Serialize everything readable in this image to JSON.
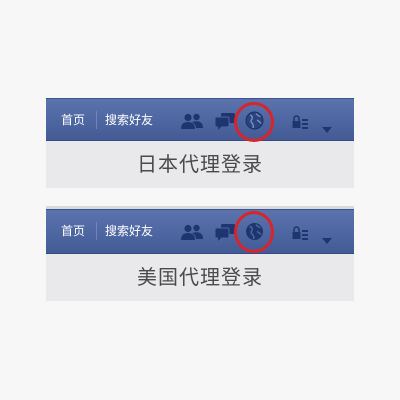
{
  "panels": [
    {
      "nav": {
        "home_label": "首页",
        "find_friends_label": "搜索好友"
      },
      "caption": "日本代理登录",
      "globe_style": "faded"
    },
    {
      "nav": {
        "home_label": "首页",
        "find_friends_label": "搜索好友"
      },
      "caption": "美国代理登录",
      "globe_style": "solid"
    }
  ],
  "colors": {
    "toolbar": "#4c65a0",
    "icon": "#1e3570",
    "highlight": "#d8242a",
    "caption_bg": "#e9e9ec",
    "caption_text": "#4a4a4a"
  },
  "icons": [
    "friend-requests-icon",
    "messages-icon",
    "notifications-globe-icon",
    "privacy-lock-icon",
    "account-caret-icon"
  ]
}
